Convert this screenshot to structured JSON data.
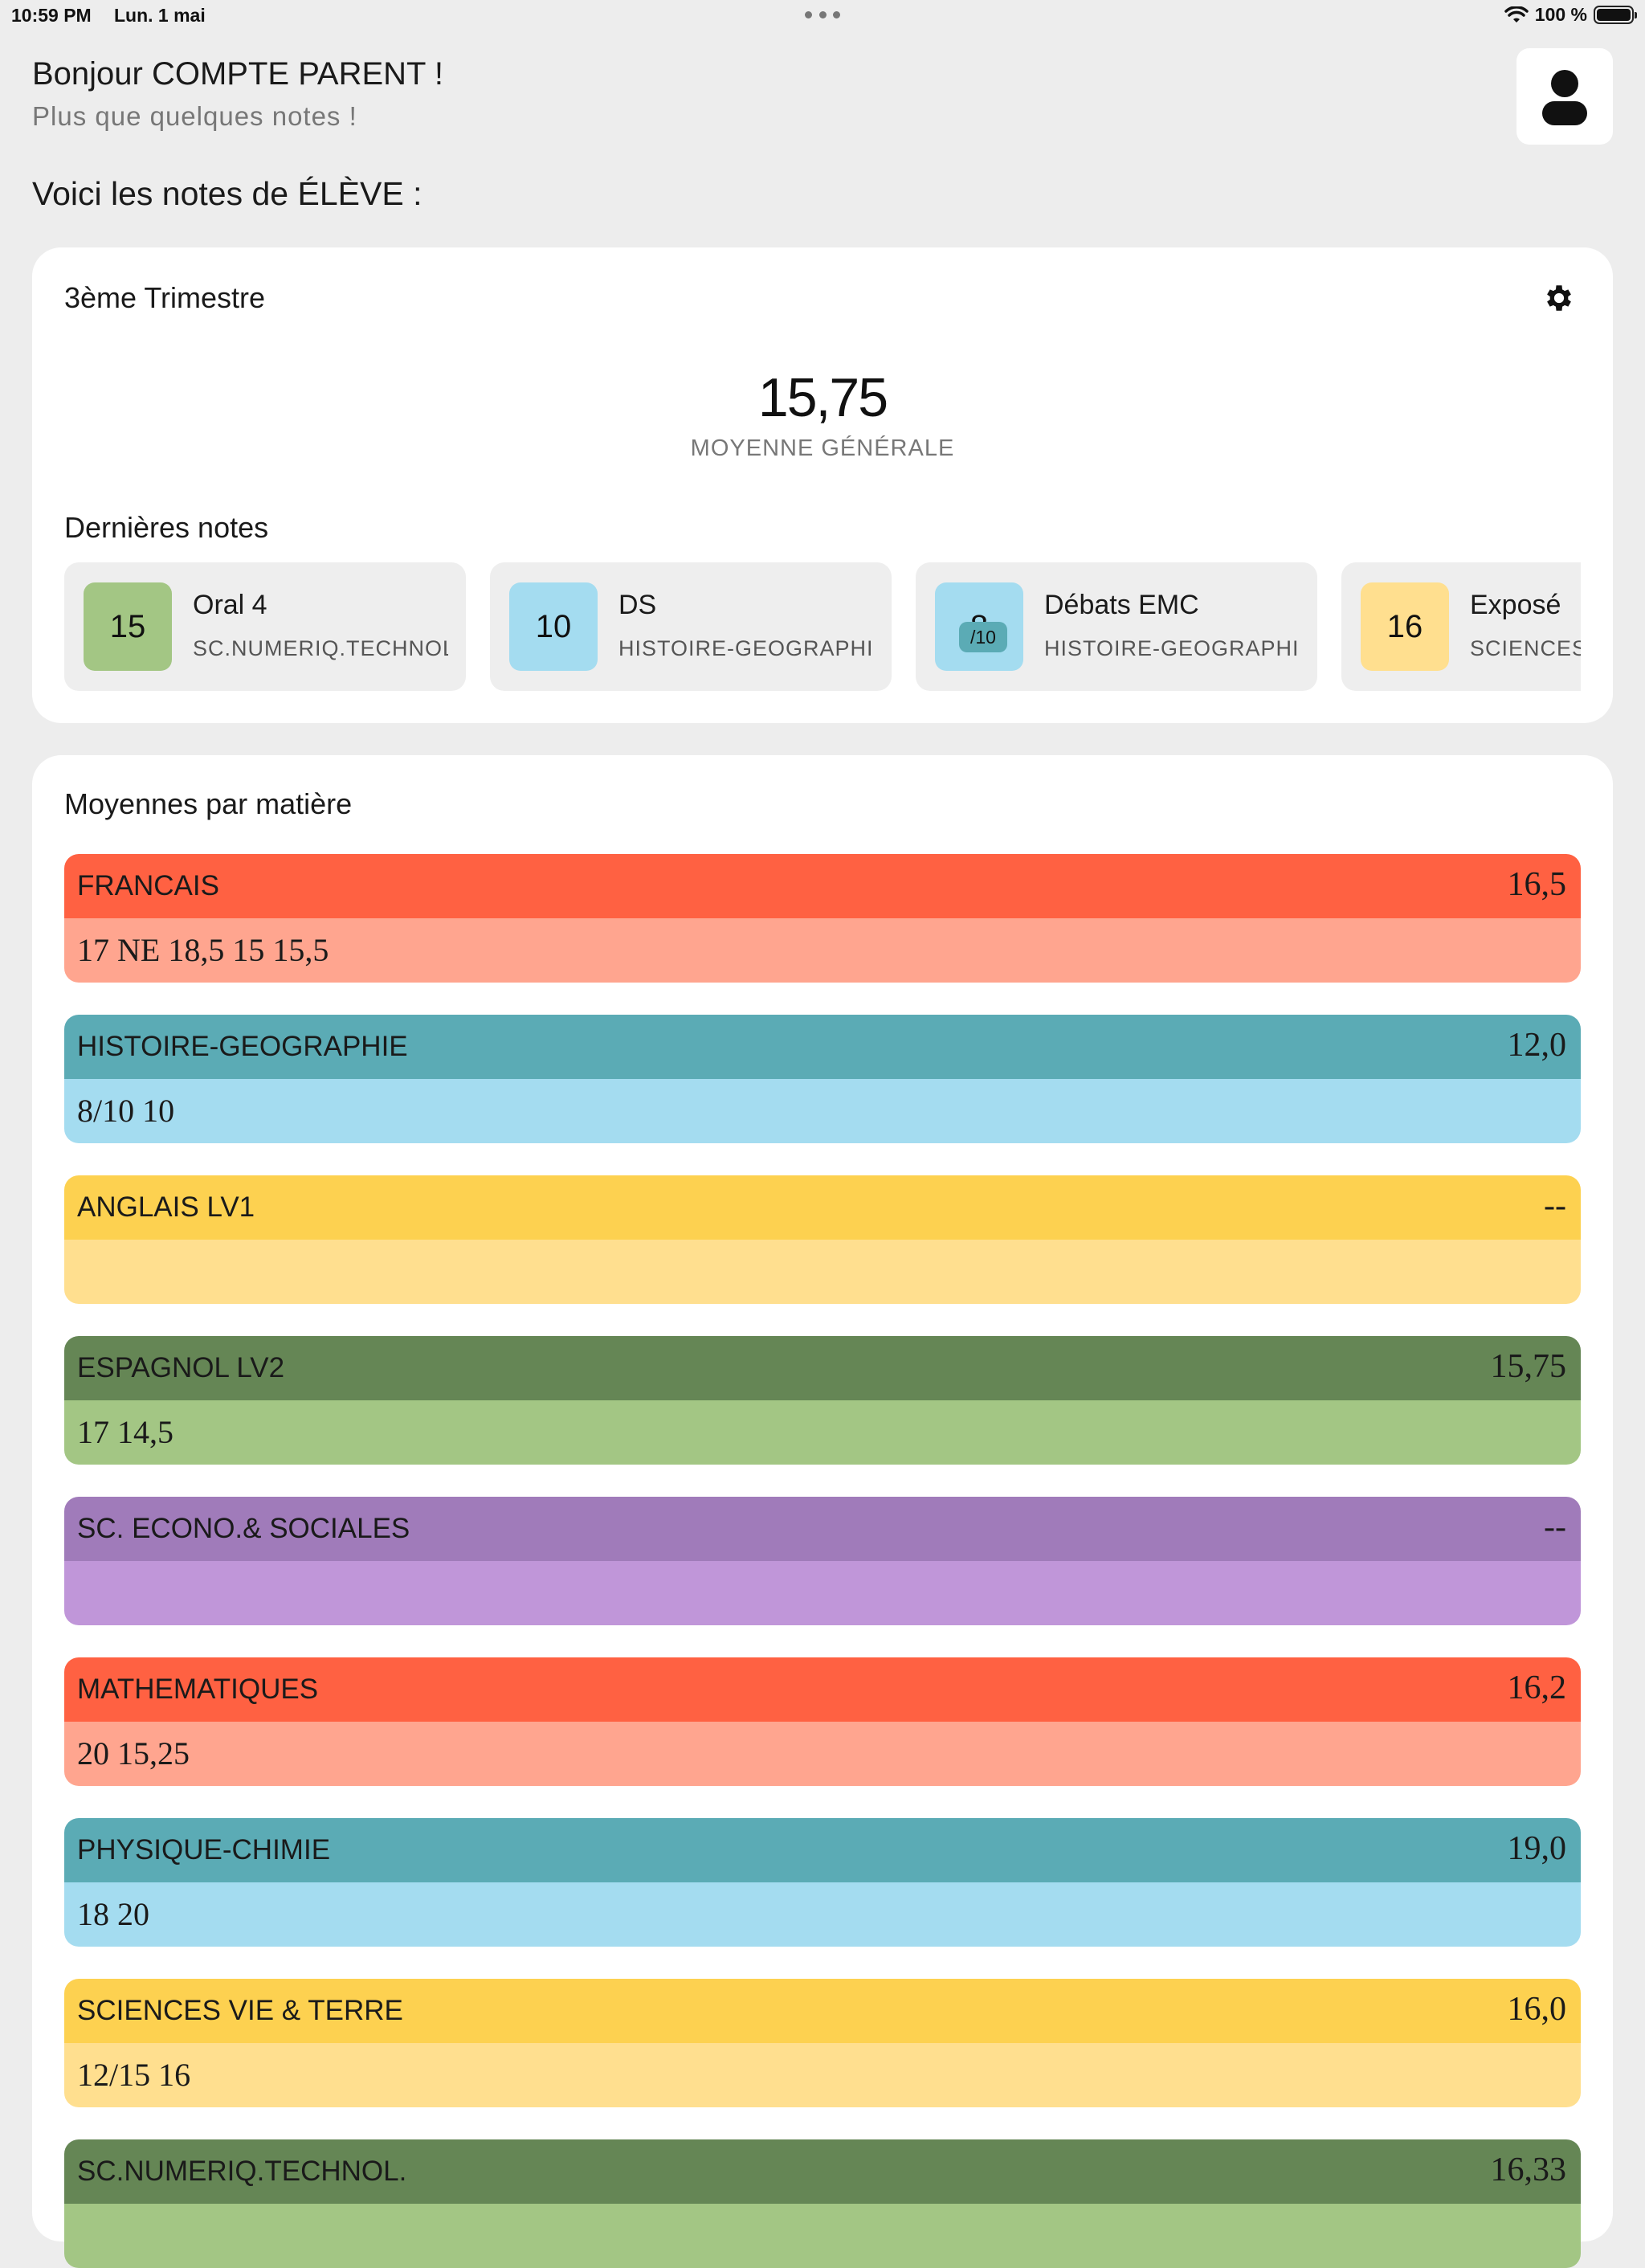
{
  "status_bar": {
    "time": "10:59 PM",
    "date": "Lun. 1 mai",
    "battery": "100 %"
  },
  "header": {
    "greeting": "Bonjour COMPTE PARENT !",
    "subtitle": "Plus que quelques notes !",
    "intro": "Voici les notes de ÉLÈVE :"
  },
  "overview": {
    "period": "3ème Trimestre",
    "average": "15,75",
    "average_label": "MOYENNE GÉNÉRALE",
    "recent_title": "Dernières notes",
    "recent": [
      {
        "grade": "15",
        "out_of": "",
        "title": "Oral 4",
        "subject": "SC.NUMERIQ.TECHNOL.",
        "color": "#a3c684"
      },
      {
        "grade": "10",
        "out_of": "",
        "title": "DS",
        "subject": "HISTOIRE-GEOGRAPHIE",
        "color": "#a4dcf0"
      },
      {
        "grade": "8",
        "out_of": "/10",
        "title": "Débats EMC",
        "subject": "HISTOIRE-GEOGRAPHIE",
        "color": "#a4dcf0"
      },
      {
        "grade": "16",
        "out_of": "",
        "title": "Exposé",
        "subject": "SCIENCES VIE & TERRE",
        "color": "#ffdf8f"
      }
    ]
  },
  "subjects_card": {
    "title": "Moyennes par matière",
    "subjects": [
      {
        "name": "FRANCAIS",
        "average": "16,5",
        "grades": "17  NE  18,5  15  15,5",
        "color_top": "#ff6142",
        "color_bottom": "#ffa58f"
      },
      {
        "name": "HISTOIRE-GEOGRAPHIE",
        "average": "12,0",
        "grades": "8/10  10",
        "color_top": "#5babb5",
        "color_bottom": "#a4dcf0"
      },
      {
        "name": "ANGLAIS LV1",
        "average": "--",
        "grades": "",
        "color_top": "#fdd150",
        "color_bottom": "#ffdf8f"
      },
      {
        "name": "ESPAGNOL LV2",
        "average": "15,75",
        "grades": "17  14,5",
        "color_top": "#658655",
        "color_bottom": "#a3c684"
      },
      {
        "name": "SC. ECONO.& SOCIALES",
        "average": "--",
        "grades": "",
        "color_top": "#a07bba",
        "color_bottom": "#c096d9"
      },
      {
        "name": "MATHEMATIQUES",
        "average": "16,2",
        "grades": "20  15,25",
        "color_top": "#ff6142",
        "color_bottom": "#ffa58f"
      },
      {
        "name": "PHYSIQUE-CHIMIE",
        "average": "19,0",
        "grades": "18  20",
        "color_top": "#5babb5",
        "color_bottom": "#a4dcf0"
      },
      {
        "name": "SCIENCES VIE & TERRE",
        "average": "16,0",
        "grades": "12/15  16",
        "color_top": "#fdd150",
        "color_bottom": "#ffdf8f"
      },
      {
        "name": "SC.NUMERIQ.TECHNOL.",
        "average": "16,33",
        "grades": "",
        "color_top": "#658655",
        "color_bottom": "#a3c684"
      }
    ]
  }
}
